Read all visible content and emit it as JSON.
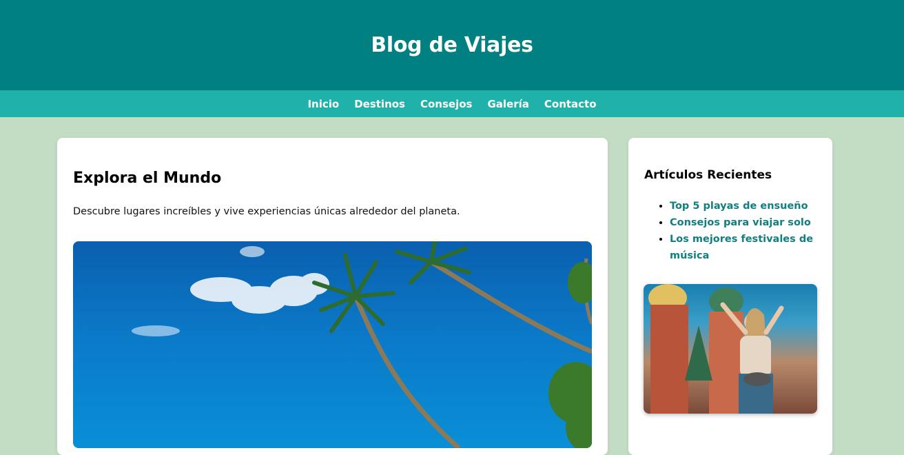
{
  "header": {
    "title": "Blog de Viajes"
  },
  "nav": {
    "items": [
      "Inicio",
      "Destinos",
      "Consejos",
      "Galería",
      "Contacto"
    ]
  },
  "main": {
    "heading": "Explora el Mundo",
    "intro": "Descubre lugares increíbles y vive experiencias únicas alrededor del planeta."
  },
  "sidebar": {
    "heading": "Artículos Recientes",
    "articles": [
      "Top 5 playas de ensueño",
      "Consejos para viajar solo",
      "Los mejores festivales de música"
    ]
  },
  "colors": {
    "header_bg": "#008080",
    "nav_bg": "#20b2aa",
    "page_bg": "#c3dcc4",
    "link": "#0f7f7f"
  }
}
